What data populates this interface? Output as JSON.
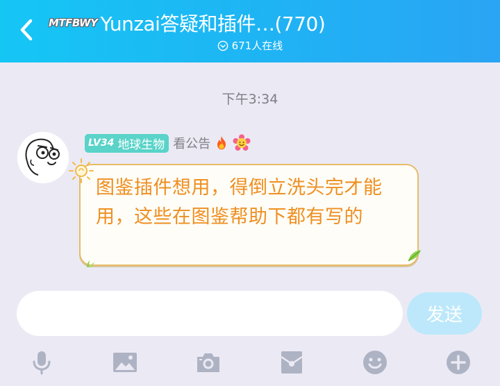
{
  "header": {
    "brand_badge": "MTFBWY",
    "title": "Yunzai答疑和插件…(770)",
    "online_count": "671人在线"
  },
  "chat": {
    "timestamp": "下午3:34",
    "message": {
      "level": "LV34",
      "sender": "地球生物",
      "sender_extra": "看公告",
      "text": "图鉴插件想用，得倒立洗头完才能用，这些在图鉴帮助下都有写的"
    }
  },
  "input": {
    "value": "",
    "placeholder": ""
  },
  "send_button": {
    "label": "发送"
  },
  "toolbar": [
    "microphone-icon",
    "image-icon",
    "camera-icon",
    "red-packet-icon",
    "emoji-icon",
    "plus-icon"
  ],
  "colors": {
    "header_start": "#15c6f5",
    "header_end": "#2aa4f4",
    "background": "#ebeaf4",
    "level_badge": "#5ad3c9",
    "bubble_text": "#ee8f21",
    "bubble_border": "#e7bb68",
    "send_button": "#bde8fb",
    "toolbar_icon": "#aeb3c4"
  }
}
